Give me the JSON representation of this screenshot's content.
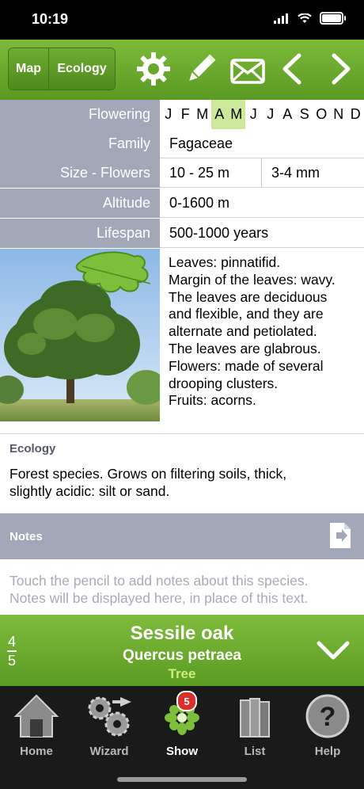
{
  "status_bar": {
    "time": "10:19"
  },
  "toolbar": {
    "map_label": "Map",
    "ecology_label": "Ecology",
    "icons": [
      "gear-icon",
      "pencil-icon",
      "envelope-icon",
      "chevron-left-icon",
      "chevron-right-icon"
    ]
  },
  "details": {
    "flowering": {
      "label": "Flowering",
      "months": [
        "J",
        "F",
        "M",
        "A",
        "M",
        "J",
        "J",
        "A",
        "S",
        "O",
        "N",
        "D"
      ],
      "active_months": [
        3,
        4
      ]
    },
    "family": {
      "label": "Family",
      "value": "Fagaceae"
    },
    "size": {
      "label": "Size - Flowers",
      "value": "10 - 25 m",
      "flowers": "3-4 mm"
    },
    "altitude": {
      "label": "Altitude",
      "value": "0-1600 m"
    },
    "lifespan": {
      "label": "Lifespan",
      "value": "500-1000 years"
    },
    "description": [
      "Leaves: pinnatifid.",
      "Margin of the leaves: wavy.",
      "The leaves are deciduous",
      "and flexible, and they are",
      "alternate and petiolated.",
      "The leaves are glabrous.",
      "Flowers: made of several",
      "drooping clusters.",
      "Fruits: acorns."
    ]
  },
  "ecology": {
    "title": "Ecology",
    "lines": [
      "Forest species. Grows on  filtering soils, thick,",
      "slightly acidic: silt or sand."
    ]
  },
  "notes": {
    "title": "Notes",
    "lines": [
      "Touch the pencil to add notes about this species.",
      "Notes will be displayed here, in place of this text."
    ]
  },
  "species": {
    "index": "4",
    "total": "5",
    "common_name": "Sessile oak",
    "latin_name": "Quercus petraea",
    "type": "Tree"
  },
  "tabbar": {
    "items": [
      {
        "label": "Home",
        "icon": "home-icon"
      },
      {
        "label": "Wizard",
        "icon": "gears-icon"
      },
      {
        "label": "Show",
        "icon": "flower-icon",
        "badge": "5"
      },
      {
        "label": "List",
        "icon": "books-icon"
      },
      {
        "label": "Help",
        "icon": "help-icon"
      }
    ],
    "active": "Show"
  },
  "colors": {
    "green_bar": "#6aa92d",
    "label_gray": "#a3a8b8",
    "highlight_month": "#cde89a",
    "species_type": "#c8f07a",
    "badge_red": "#d9302a"
  }
}
